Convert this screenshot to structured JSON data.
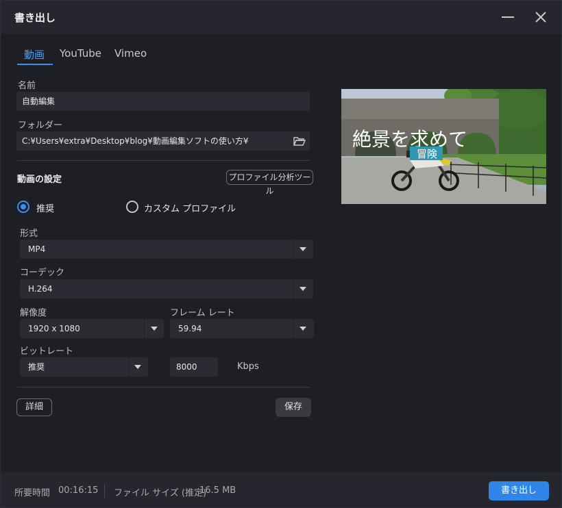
{
  "window": {
    "title": "書き出し"
  },
  "tabs": [
    {
      "label": "動画"
    },
    {
      "label": "YouTube"
    },
    {
      "label": "Vimeo"
    }
  ],
  "name_field": {
    "label": "名前",
    "value": "自動編集"
  },
  "folder_field": {
    "label": "フォルダー",
    "value": "C:¥Users¥extra¥Desktop¥blog¥動画編集ソフトの使い方¥"
  },
  "video_settings": {
    "title": "動画の設定",
    "profile_tool_label": "プロファイル分析ツール",
    "radio_recommended": "推奨",
    "radio_custom": "カスタム プロファイル"
  },
  "format": {
    "label": "形式",
    "value": "MP4"
  },
  "codec": {
    "label": "コーデック",
    "value": "H.264"
  },
  "resolution": {
    "label": "解像度",
    "value": "1920 x 1080"
  },
  "frame_rate": {
    "label": "フレーム レート",
    "value": "59.94"
  },
  "bitrate": {
    "label": "ビットレート",
    "value": "推奨",
    "number": "8000",
    "unit": "Kbps"
  },
  "buttons": {
    "details": "詳細",
    "save": "保存",
    "export": "書き出し"
  },
  "preview": {
    "caption_main": "絶景を求めて",
    "caption_sub": "冒険"
  },
  "status": {
    "time_label": "所要時間",
    "time_value": "00:16:15",
    "size_label": "ファイル サイズ (推定)",
    "size_value": "16.5 MB"
  },
  "colors": {
    "accent": "#3a8ef0",
    "background": "#1e1f25",
    "field": "#2b2c33"
  }
}
